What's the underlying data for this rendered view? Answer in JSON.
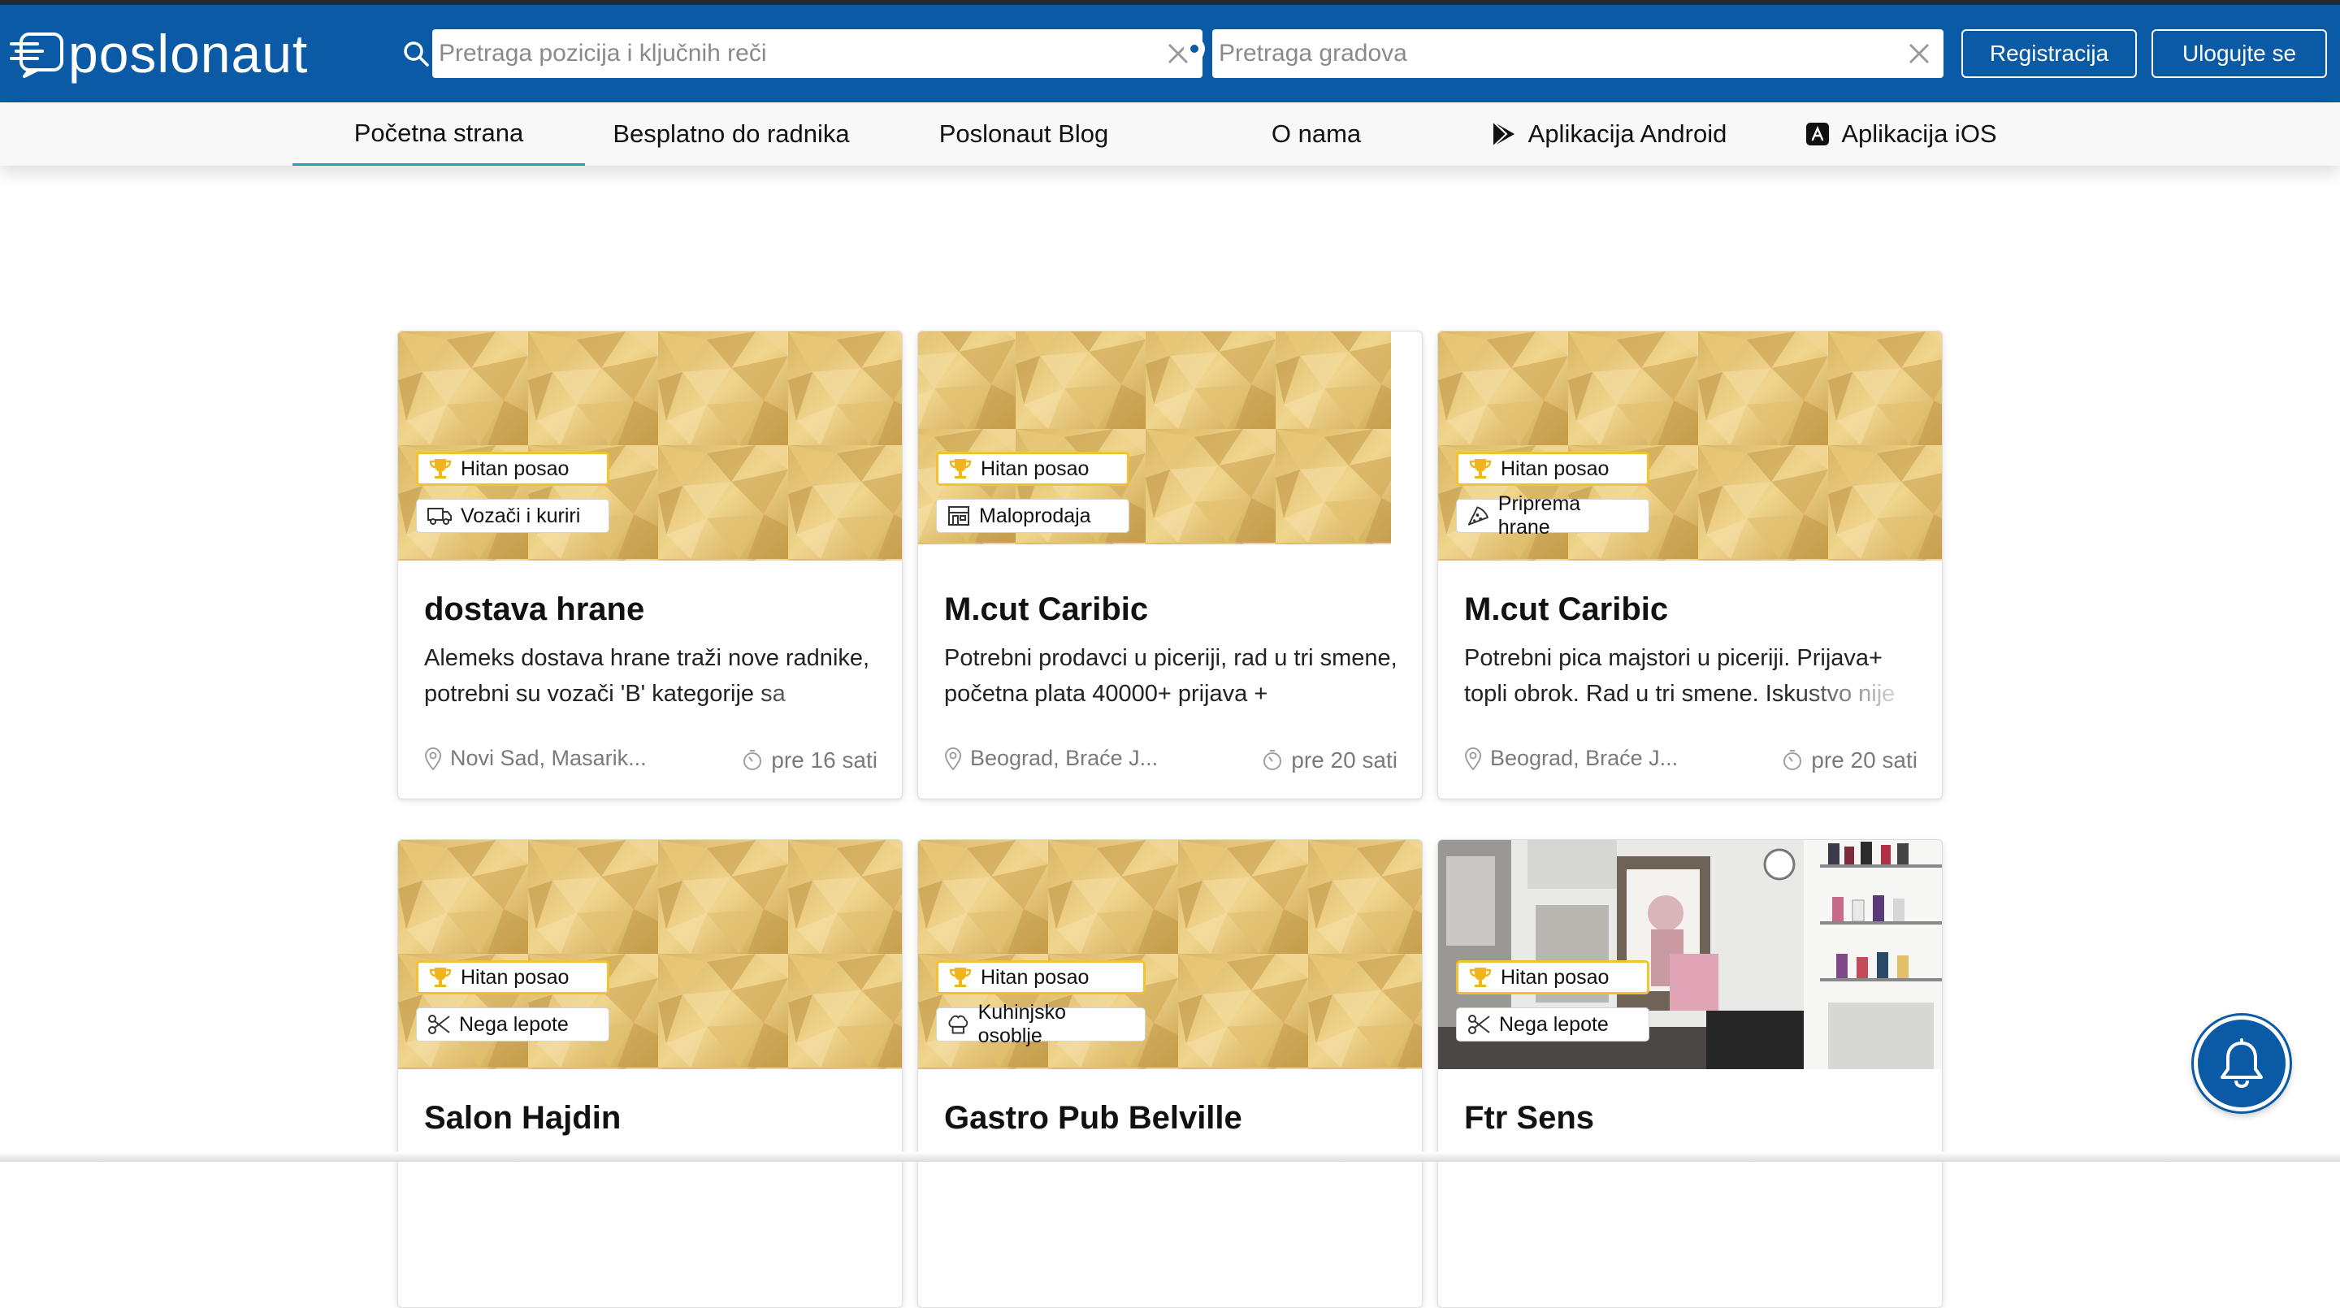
{
  "header": {
    "logo_text": "poslonaut",
    "search_position_placeholder": "Pretraga pozicija i ključnih reči",
    "search_city_placeholder": "Pretraga gradova",
    "register_label": "Registracija",
    "login_label": "Ulogujte se"
  },
  "nav": {
    "items": [
      {
        "label": "Početna strana",
        "active": true
      },
      {
        "label": "Besplatno do radnika"
      },
      {
        "label": "Poslonaut Blog"
      },
      {
        "label": "O nama"
      },
      {
        "label": "Aplikacija Android",
        "icon": "play-store-icon"
      },
      {
        "label": "Aplikacija iOS",
        "icon": "app-store-icon"
      }
    ]
  },
  "cards": [
    {
      "title": "dostava hrane",
      "urgent": "Hitan posao",
      "category": "Vozači i kuriri",
      "category_icon": "delivery-truck-icon",
      "description": "Alemeks dostava hrane traži nove radnike, potrebni su vozači 'B' kategorije sa",
      "location": "Novi Sad, Masarik...",
      "time": "pre 16 sati"
    },
    {
      "title": "M.cut Caribic",
      "urgent": "Hitan posao",
      "category": "Maloprodaja",
      "category_icon": "shop-icon",
      "description": "Potrebni prodavci u piceriji, rad u tri smene, početna plata 40000+ prijava +",
      "location": "Beograd, Braće J...",
      "time": "pre 20 sati"
    },
    {
      "title": "M.cut Caribic",
      "urgent": "Hitan posao",
      "category": "Priprema hrane",
      "category_icon": "pizza-icon",
      "description": "Potrebni pica majstori u piceriji. Prijava+ topli obrok. Rad u tri smene. Iskustvo nije",
      "location": "Beograd, Braće J...",
      "time": "pre 20 sati"
    },
    {
      "title": "Salon Hajdin",
      "urgent": "Hitan posao",
      "category": "Nega lepote",
      "category_icon": "scissors-icon"
    },
    {
      "title": "Gastro Pub Belville",
      "urgent": "Hitan posao",
      "category": "Kuhinjsko osoblje",
      "category_icon": "chef-hat-icon"
    },
    {
      "title": "Ftr Sens",
      "urgent": "Hitan posao",
      "category": "Nega lepote",
      "category_icon": "scissors-icon",
      "image": "salon-photo"
    }
  ],
  "colors": {
    "brand_blue": "#0b5aa5",
    "urgent_border": "#f1c232",
    "active_tab_underline": "#2a9bb0"
  }
}
